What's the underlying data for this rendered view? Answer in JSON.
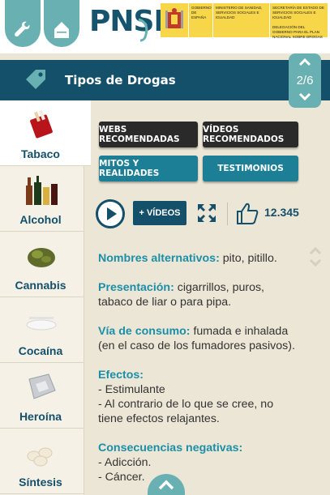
{
  "app": {
    "logo": "PNSD",
    "gov_labels": {
      "gobierno": "GOBIERNO DE ESPAÑA",
      "ministerio": "MINISTERIO DE SANIDAD, SERVICIOS SOCIALES E IGUALDAD",
      "secretaria": "SECRETARÍA DE ESTADO DE SERVICIOS SOCIALES E IGUALDAD",
      "delegacion": "DELEGACIÓN DEL GOBIERNO PARA EL PLAN NACIONAL SOBRE DROGAS"
    }
  },
  "header": {
    "title": "Tipos de Drogas",
    "pager": "2/6"
  },
  "sidebar": {
    "items": [
      {
        "label": "Tabaco"
      },
      {
        "label": "Alcohol"
      },
      {
        "label": "Cannabis"
      },
      {
        "label": "Cocaína"
      },
      {
        "label": "Heroína"
      },
      {
        "label": "Síntesis"
      }
    ]
  },
  "buttons": {
    "web": "WEBS RECOMENDADAS",
    "videos_rec": "VÍDEOS RECOMENDADOS",
    "mitos": "MITOS Y REALIDADES",
    "testimonios": "TESTIMONIOS"
  },
  "media": {
    "videos_label": "+ VÍDEOS",
    "likes": "12.345"
  },
  "content": {
    "nombres_label": "Nombres alternativos:",
    "nombres_value": " pito, pitillo.",
    "presentacion_label": "Presentación:",
    "presentacion_value": " cigarrillos, puros, tabaco de liar o para pipa.",
    "via_label": "Vía de consumo:",
    "via_value": " fumada e inhalada (en el caso de los fumadores pasivos).",
    "efectos_label": "Efectos:",
    "efectos_1": "- Estimulante",
    "efectos_2": "- Al contrario de lo que se cree, no tiene efectos relajantes.",
    "consecuencias_label": "Consecuencias negativas:",
    "consecuencias_1": "- Adicción.",
    "consecuencias_2": "- Cáncer."
  },
  "colors": {
    "primary": "#14506a",
    "accent": "#69b0b3",
    "term": "#1b8fa8"
  }
}
